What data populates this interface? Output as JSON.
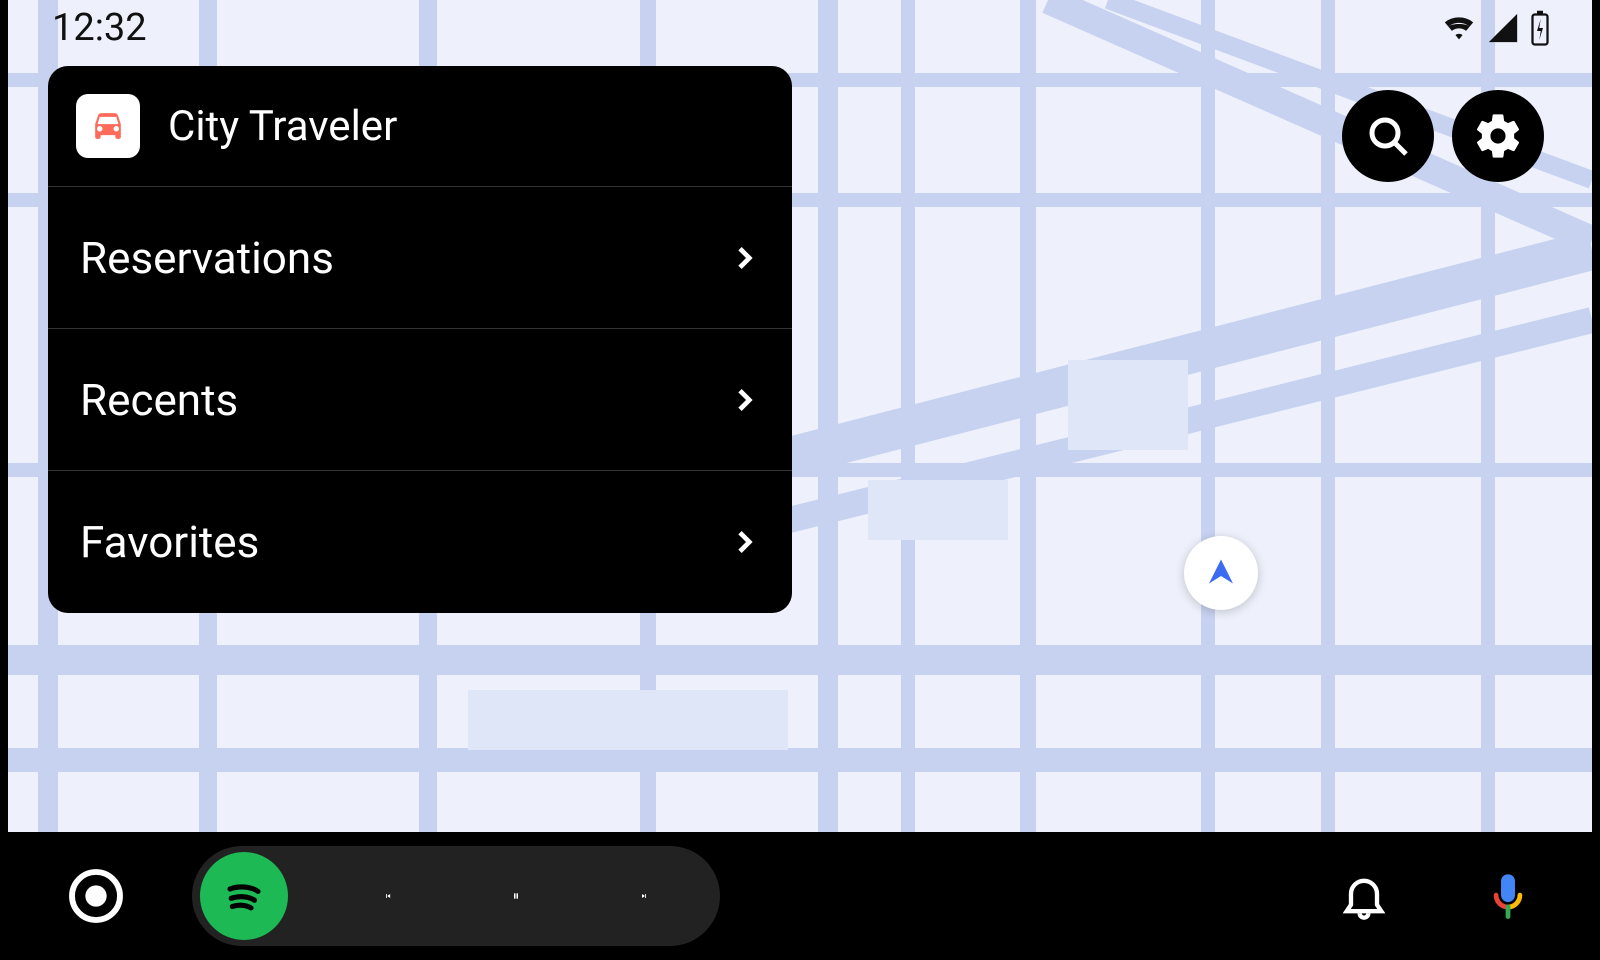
{
  "status": {
    "time": "12:32"
  },
  "panel": {
    "app_name": "City Traveler",
    "items": [
      {
        "label": "Reservations"
      },
      {
        "label": "Recents"
      },
      {
        "label": "Favorites"
      }
    ]
  },
  "icons": {
    "search": "search-icon",
    "settings": "gear-icon",
    "location": "location-arrow-icon",
    "wifi": "wifi-icon",
    "signal": "cell-signal-icon",
    "battery": "battery-charging-icon",
    "launcher": "app-launcher-icon",
    "spotify": "spotify-icon",
    "prev": "skip-previous-icon",
    "pause": "pause-icon",
    "next": "skip-next-icon",
    "bell": "bell-icon",
    "mic": "microphone-icon",
    "car": "car-icon",
    "chevron": "chevron-right-icon"
  },
  "colors": {
    "accent_spotify": "#1DB954",
    "car_icon": "#FF6B5B",
    "mic_blue": "#4285F4",
    "mic_red": "#EA4335",
    "mic_yellow": "#FBBC05",
    "mic_green": "#34A853"
  }
}
